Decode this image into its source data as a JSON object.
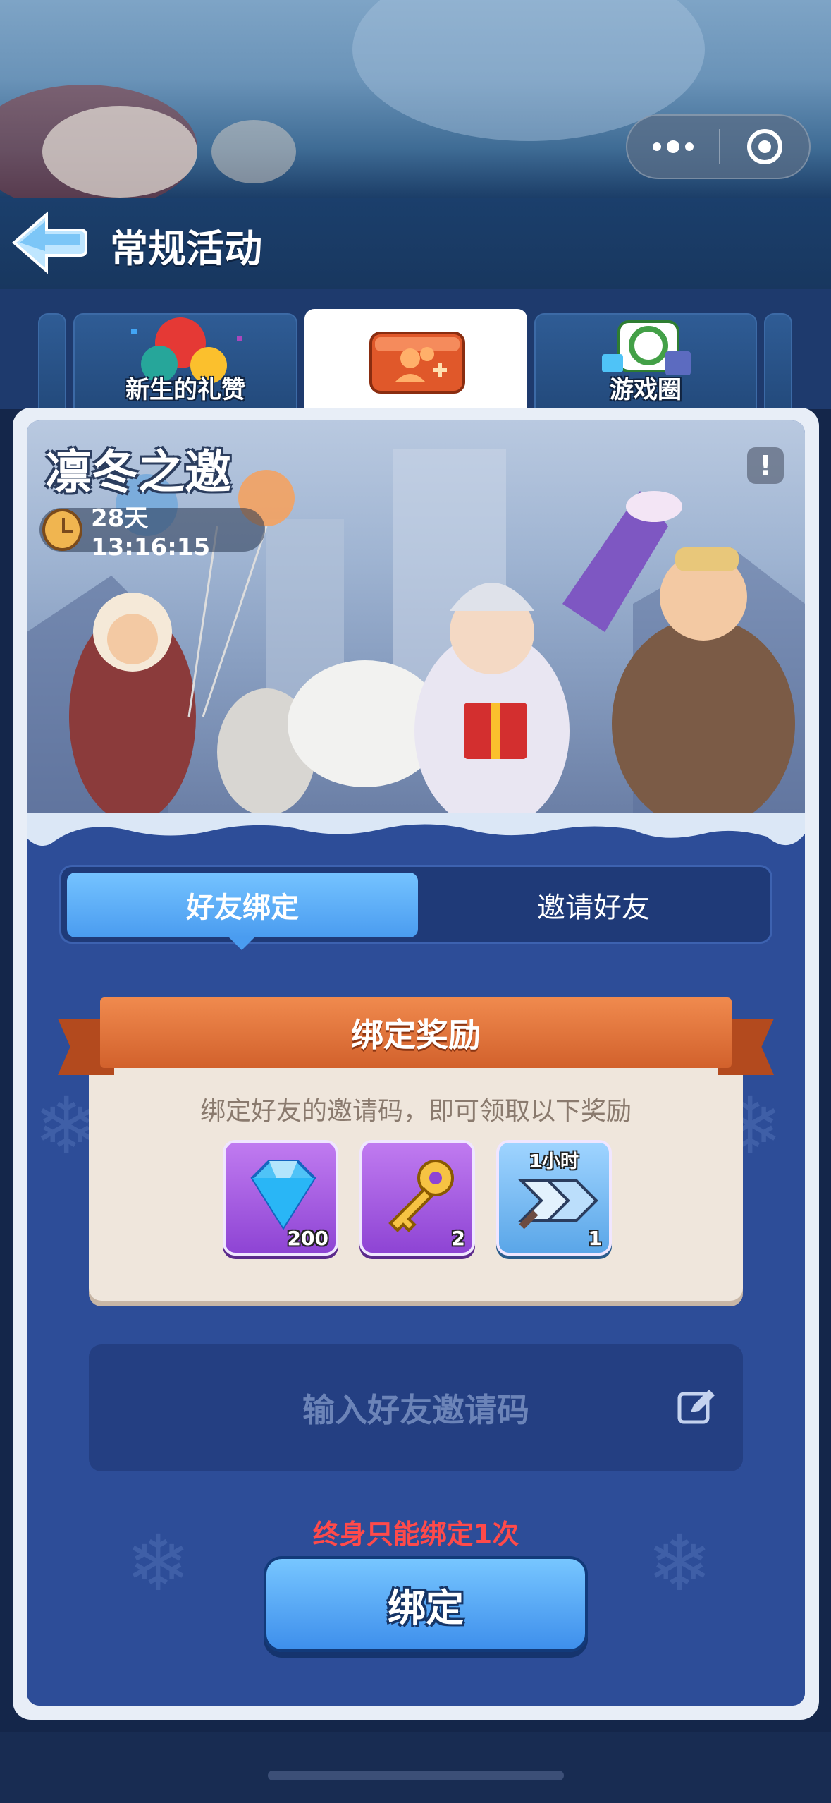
{
  "header": {
    "title": "常规活动",
    "capsule": {
      "more_icon": "more-dots-icon",
      "close_icon": "target-close-icon"
    }
  },
  "tabs": [
    {
      "label": "新生的礼赞",
      "icon": "balloon-icon",
      "active": false
    },
    {
      "label": "",
      "icon": "friend-invite-icon",
      "active": true
    },
    {
      "label": "游戏圈",
      "icon": "game-circle-icon",
      "active": false
    }
  ],
  "banner": {
    "title": "凛冬之邀",
    "timer": "28天 13:16:15"
  },
  "segment": {
    "left_label": "好友绑定",
    "right_label": "邀请好友",
    "selected": "left"
  },
  "rewards": {
    "title": "绑定奖励",
    "description": "绑定好友的邀请码，即可领取以下奖励",
    "items": [
      {
        "icon": "diamond-icon",
        "count": "200"
      },
      {
        "icon": "key-icon",
        "count": "2"
      },
      {
        "icon": "speedup-icon",
        "tag": "1小时",
        "count": "1"
      }
    ]
  },
  "code_input": {
    "placeholder": "输入好友邀请码"
  },
  "notice": "终身只能绑定1次",
  "bind_button": "绑定",
  "colors": {
    "accent_blue": "#4a9cf0",
    "ribbon_orange": "#d2612c",
    "notice_red": "#ff4a4a",
    "panel_blue": "#2d4d98"
  }
}
